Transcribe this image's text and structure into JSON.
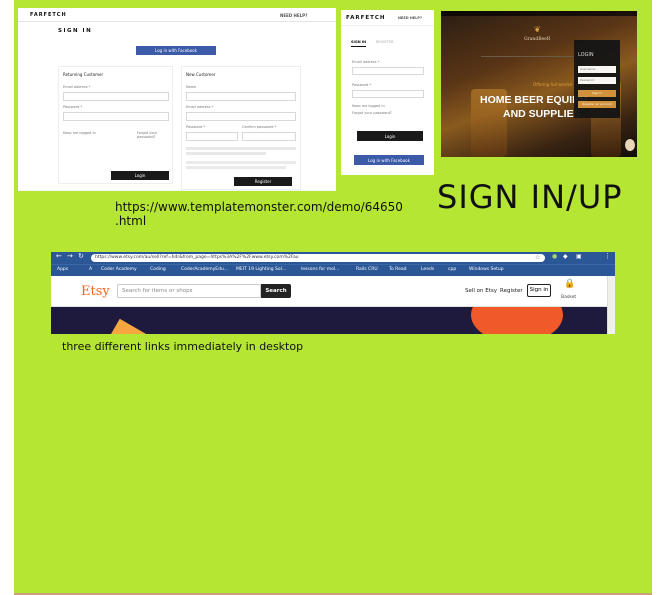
{
  "notes": {
    "url": "https://www.templatemonster.com/demo/64650.html",
    "heading": "SIGN IN/UP",
    "caption": "three different links immediately in desktop"
  },
  "farfetch_desktop": {
    "brand": "FARFETCH",
    "header_help": "NEED HELP?",
    "page_title": "SIGN IN",
    "facebook_button": "Log in with Facebook",
    "returning_title": "Returning Customer",
    "email_label": "Email address *",
    "password_label": "Password *",
    "keep_logged": "Keep me logged in",
    "forgot_password": "Forgot your password?",
    "login_button": "Login",
    "new_title": "New Customer",
    "name_label": "Name",
    "new_email_label": "Email address *",
    "new_password_label": "Password *",
    "confirm_label": "Confirm password *",
    "register_button": "Register"
  },
  "farfetch_mobile": {
    "brand": "FARFETCH",
    "header_help": "NEED HELP?",
    "tab_signin": "SIGN IN",
    "tab_register": "REGISTER",
    "email_label": "Email address *",
    "password_label": "Password *",
    "keep_logged": "Keep me logged in",
    "forgot_password": "Forgot your password?",
    "login_button": "Login",
    "facebook_button": "Log in with Facebook"
  },
  "beer_site": {
    "logo": "GrandBeeR",
    "tagline": "Offering full service",
    "headline_1": "HOME BEER EQUIPM",
    "headline_2": "AND SUPPLIES",
    "login_title": "LOGIN",
    "username_ph": "Username",
    "password_ph": "Password",
    "signin_button": "Sign in",
    "register_button": "Register an account"
  },
  "etsy": {
    "address": "https://www.etsy.com/au/sell?ref=hdr&from_page=https%3A%2F%2Fwww.etsy.com%2Fau",
    "bookmarks": [
      "Apps",
      "A",
      "Coder Academy",
      "Coding",
      "CoderAcademyEdu...",
      "MEIT 19 Lighting Sol...",
      "lessons for mol...",
      "Rails CRU",
      "To Read",
      "Leeds",
      "cpp",
      "Windows Setup"
    ],
    "logo": "Etsy",
    "search_placeholder": "Search for items or shops",
    "search_button": "Search",
    "sell_link": "Sell on Etsy",
    "register_link": "Register",
    "signin_button": "Sign in",
    "basket_label": "Basket"
  }
}
